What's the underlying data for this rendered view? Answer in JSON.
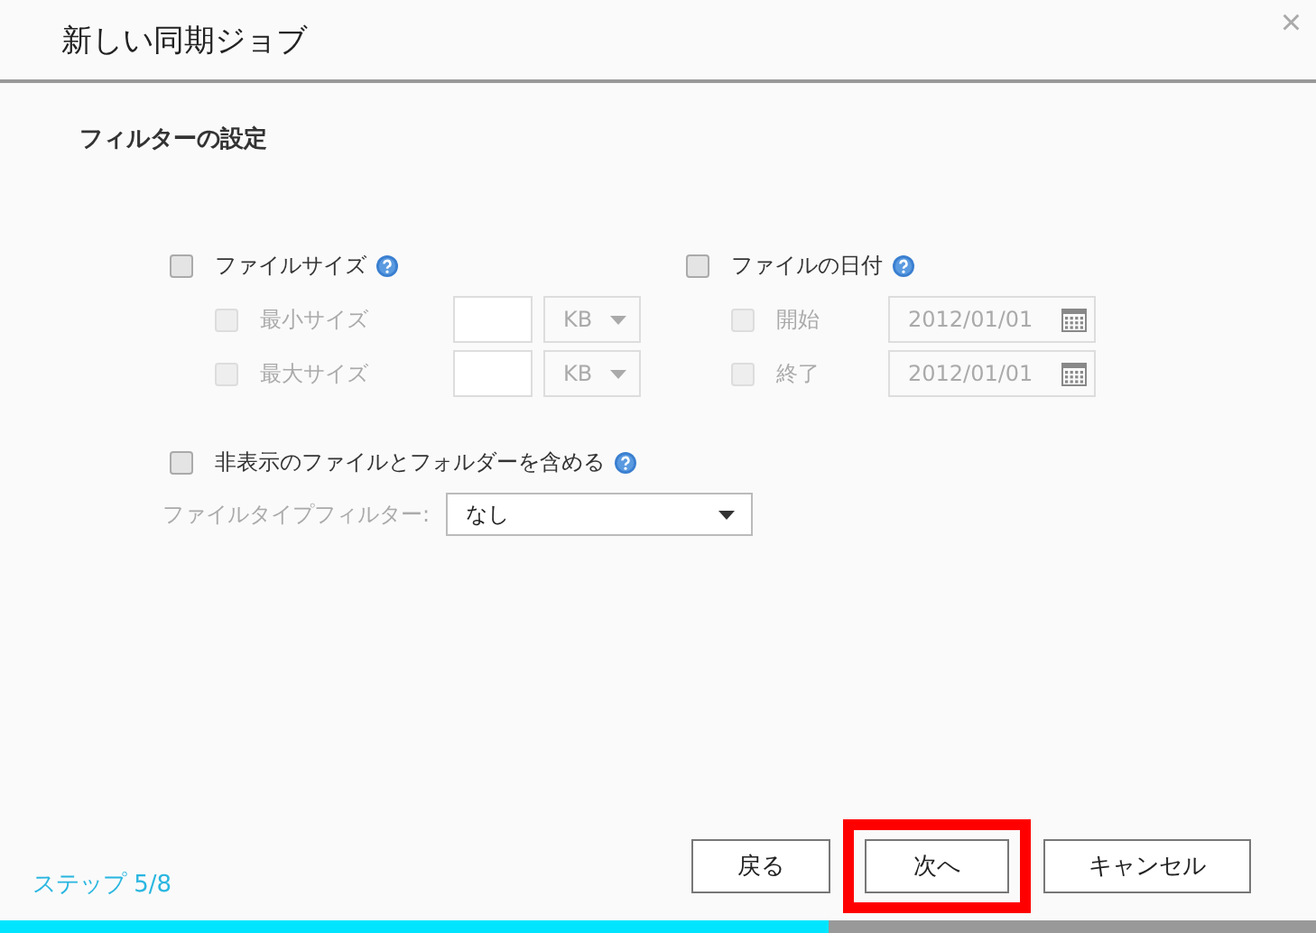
{
  "window": {
    "title": "新しい同期ジョブ",
    "close": "×"
  },
  "section_title": "フィルターの設定",
  "size_filter": {
    "label": "ファイルサイズ",
    "checked": false,
    "rows": [
      {
        "label": "最小サイズ",
        "checked": false,
        "disabled": true,
        "unit": "KB"
      },
      {
        "label": "最大サイズ",
        "checked": false,
        "disabled": true,
        "unit": "KB"
      }
    ]
  },
  "date_filter": {
    "label": "ファイルの日付",
    "checked": false,
    "rows": [
      {
        "label": "開始",
        "checked": false,
        "disabled": true,
        "value": "2012/01/01"
      },
      {
        "label": "終了",
        "checked": false,
        "disabled": true,
        "value": "2012/01/01"
      }
    ]
  },
  "hidden_files": {
    "label": "非表示のファイルとフォルダーを含める",
    "checked": false
  },
  "file_type_filter": {
    "label": "ファイルタイプフィルター:",
    "value": "なし"
  },
  "step": "ステップ 5/8",
  "buttons": [
    {
      "label": "戻る",
      "highlighted": false
    },
    {
      "label": "次へ",
      "highlighted": true
    },
    {
      "label": "キャンセル",
      "highlighted": false
    }
  ],
  "progress": {
    "level": 0.63
  }
}
